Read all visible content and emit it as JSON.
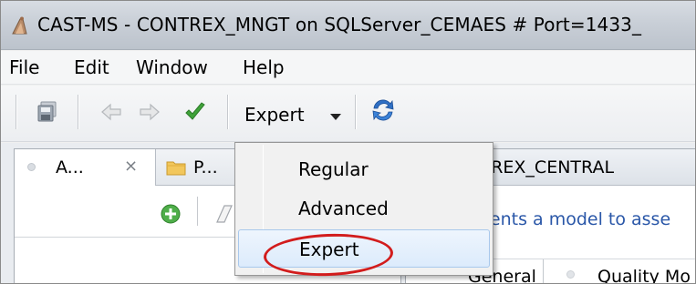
{
  "window": {
    "title": "CAST-MS - CONTREX_MNGT on SQLServer_CEMAES # Port=1433_"
  },
  "menubar": {
    "items": [
      "File",
      "Edit",
      "Window",
      "Help"
    ]
  },
  "toolbar": {
    "perspective_label": "Expert",
    "icons": [
      "save-all-icon",
      "back-icon",
      "forward-icon",
      "checkmark-icon",
      "refresh-icon"
    ]
  },
  "left_view": {
    "tabs": [
      {
        "label": "A...",
        "icon": "view-dot-icon",
        "closable": true
      },
      {
        "label": "P...",
        "icon": "folder-icon"
      }
    ],
    "toolbar_icons": [
      "add-icon",
      "eraser-icon"
    ]
  },
  "right_view": {
    "tab_label": "ITREX_CENTRAL",
    "description": "sents a model to asse",
    "bottom_tabs": [
      "General",
      "Quality Mo"
    ]
  },
  "dropdown": {
    "items": [
      {
        "label": "Regular",
        "selected": false
      },
      {
        "label": "Advanced",
        "selected": false
      },
      {
        "label": "Expert",
        "selected": true
      }
    ]
  },
  "colors": {
    "highlight_circle": "#d21c1c",
    "selection_border": "#a8c8ec",
    "link_text": "#2a57a8"
  }
}
